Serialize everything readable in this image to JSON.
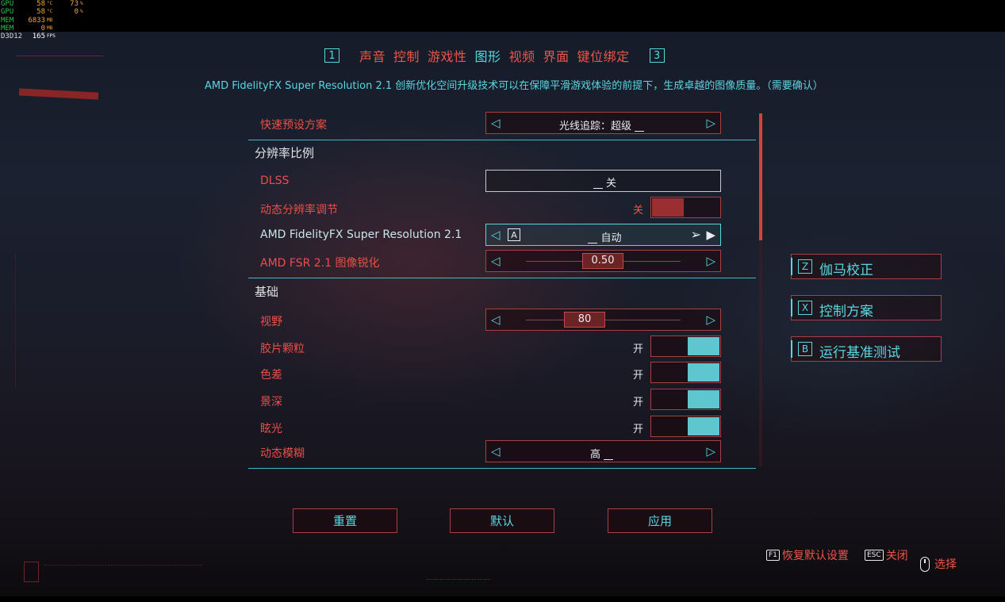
{
  "overlay": {
    "rows": [
      {
        "key": "GPU",
        "v1": "58",
        "u1": "°C",
        "v2": "73",
        "u2": "%"
      },
      {
        "key": "GPU",
        "v1": "58",
        "u1": "°C",
        "v2": "0",
        "u2": "%"
      },
      {
        "key": "MEM",
        "v1": "6833",
        "u1": "MB",
        "v2": "",
        "u2": ""
      },
      {
        "key": "MEM",
        "v1": "0",
        "u1": "MB",
        "v2": "",
        "u2": ""
      },
      {
        "key": "D3D12",
        "v1": "165",
        "u1": "FPS",
        "v2": "",
        "u2": ""
      }
    ]
  },
  "tabs": {
    "left_key": "1",
    "right_key": "3",
    "items": [
      {
        "label": "声音"
      },
      {
        "label": "控制"
      },
      {
        "label": "游戏性"
      },
      {
        "label": "图形"
      },
      {
        "label": "视频"
      },
      {
        "label": "界面"
      },
      {
        "label": "键位绑定"
      }
    ],
    "active": "图形"
  },
  "description": "AMD FidelityFX Super Resolution 2.1 创新优化空间升级技术可以在保障平滑游戏体验的前提下，生成卓越的图像质量。（需要确认）",
  "settings": {
    "quick_preset": {
      "label": "快速预设方案",
      "value": "光线追踪：超级"
    },
    "section_resolution": "分辨率比例",
    "dlss": {
      "label": "DLSS",
      "value": "关"
    },
    "dynamic_res": {
      "label": "动态分辨率调节",
      "state": "关"
    },
    "fsr": {
      "label": "AMD FidelityFX Super Resolution 2.1",
      "key": "A",
      "value": "自动"
    },
    "fsr_sharpen": {
      "label": "AMD FSR 2.1 图像锐化",
      "value": "0.50",
      "level": 0.5
    },
    "section_basic": "基础",
    "fov": {
      "label": "视野",
      "value": "80",
      "level": 0.4
    },
    "film_grain": {
      "label": "胶片颗粒",
      "state": "开"
    },
    "chromatic": {
      "label": "色差",
      "state": "开"
    },
    "dof": {
      "label": "景深",
      "state": "开"
    },
    "lens_flare": {
      "label": "眩光",
      "state": "开"
    },
    "motion_blur": {
      "label": "动态模糊",
      "value": "高"
    }
  },
  "side_buttons": [
    {
      "key": "Z",
      "label": "伽马校正"
    },
    {
      "key": "X",
      "label": "控制方案"
    },
    {
      "key": "B",
      "label": "运行基准测试"
    }
  ],
  "bottom_buttons": {
    "reset": "重置",
    "default": "默认",
    "apply": "应用"
  },
  "hints": {
    "restore_key": "F1",
    "restore": "恢复默认设置",
    "close_key": "ESC",
    "close": "关闭",
    "select": "选择"
  },
  "colors": {
    "accent": "#56d7de",
    "primary": "#ef5448",
    "border": "#a64043"
  }
}
